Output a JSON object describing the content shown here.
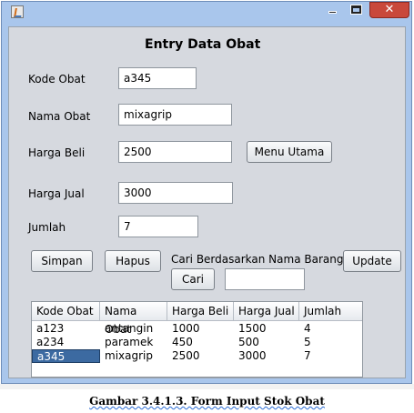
{
  "titlebar": {
    "app_icon": "java-cup-icon",
    "minimize_icon": "minimize-icon",
    "maximize_icon": "maximize-icon",
    "close_glyph": "✕"
  },
  "form": {
    "heading": "Entry Data Obat",
    "kode_obat": {
      "label": "Kode Obat",
      "value": "a345"
    },
    "nama_obat": {
      "label": "Nama Obat",
      "value": "mixagrip"
    },
    "harga_beli": {
      "label": "Harga Beli",
      "value": "2500"
    },
    "harga_jual": {
      "label": "Harga Jual",
      "value": "3000"
    },
    "jumlah": {
      "label": "Jumlah",
      "value": "7"
    },
    "menu_utama_label": "Menu Utama",
    "simpan_label": "Simpan",
    "hapus_label": "Hapus",
    "update_label": "Update",
    "search": {
      "label": "Cari Berdasarkan Nama Barang",
      "button_label": "Cari",
      "value": ""
    }
  },
  "table": {
    "columns": [
      "Kode Obat",
      "Nama Obat",
      "Harga Beli",
      "Harga Jual",
      "Jumlah"
    ],
    "rows": [
      [
        "a123",
        "antangin",
        "1000",
        "1500",
        "4"
      ],
      [
        "a234",
        "paramek",
        "450",
        "500",
        "5"
      ],
      [
        "a345",
        "mixagrip",
        "2500",
        "3000",
        "7"
      ]
    ],
    "selected_row": 2
  },
  "caption": "Gambar 3.4.1.3. Form Input Stok Obat"
}
